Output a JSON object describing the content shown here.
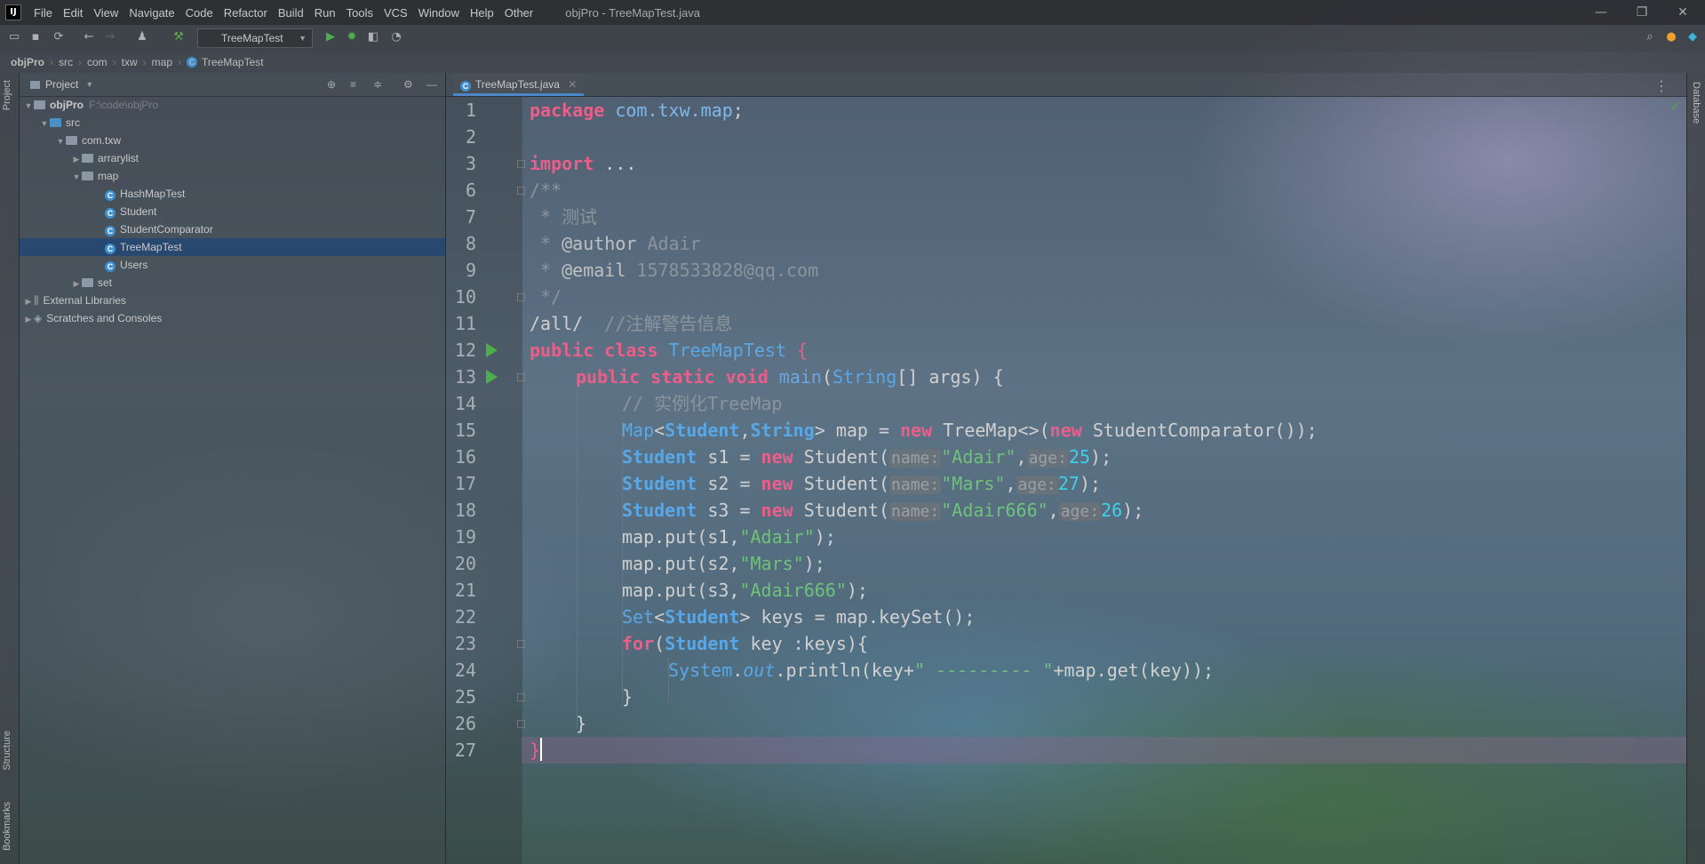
{
  "titlebar": {
    "logo": "IJ",
    "menu": [
      "File",
      "Edit",
      "View",
      "Navigate",
      "Code",
      "Refactor",
      "Build",
      "Run",
      "Tools",
      "VCS",
      "Window",
      "Help",
      "Other"
    ],
    "title": "objPro - TreeMapTest.java",
    "minimize": "—",
    "restore": "❐",
    "close": "✕"
  },
  "toolbar": {
    "run_config": "TreeMapTest"
  },
  "breadcrumb": [
    "objPro",
    "src",
    "com",
    "txw",
    "map",
    "TreeMapTest"
  ],
  "left_strip": {
    "project_tab": "Project",
    "structure_tab": "Structure",
    "bookmarks_tab": "Bookmarks"
  },
  "right_strip": {
    "database_tab": "Database"
  },
  "project_panel": {
    "title": "Project",
    "tree": [
      {
        "label": "objPro",
        "hint": "F:\\code\\objPro"
      },
      {
        "label": "src"
      },
      {
        "label": "com.txw"
      },
      {
        "label": "arrarylist"
      },
      {
        "label": "map"
      },
      {
        "label": "HashMapTest"
      },
      {
        "label": "Student"
      },
      {
        "label": "StudentComparator"
      },
      {
        "label": "TreeMapTest"
      },
      {
        "label": "Users"
      },
      {
        "label": "set"
      },
      {
        "label": "External Libraries"
      },
      {
        "label": "Scratches and Consoles"
      }
    ]
  },
  "editor": {
    "tab_label": "TreeMapTest.java",
    "line_numbers": [
      "1",
      "2",
      "3",
      "6",
      "7",
      "8",
      "9",
      "10",
      "11",
      "12",
      "13",
      "14",
      "15",
      "16",
      "17",
      "18",
      "19",
      "20",
      "21",
      "22",
      "23",
      "24",
      "25",
      "26",
      "27"
    ],
    "code": {
      "l1_kw": "package",
      "l1_pkg": "com.txw.map",
      "l1_end": ";",
      "l3_kw": "import",
      "l3_rest": " ...",
      "l6": "/**",
      "l7": " * 测试",
      "l8_a": " * ",
      "l8_tag": "@author",
      "l8_b": " Adair",
      "l9_a": " * ",
      "l9_tag": "@email",
      "l9_b": " 1578533828@qq.com",
      "l10": " */",
      "l11_a": "/all/  ",
      "l11_cmt": "//注解警告信息",
      "l12_kw": "public class",
      "l12_name": "TreeMapTest",
      "l12_brace": "{",
      "l13_kw": "public static void",
      "l13_fn": "main",
      "l13_type": "String",
      "l13_rest": "[] args) {",
      "l14": "// 实例化TreeMap",
      "l15_map": "Map",
      "l15_lt": "<",
      "l15_t1": "Student",
      "l15_c": ",",
      "l15_t2": "String",
      "l15_rest1": "> map = ",
      "l15_new1": "new",
      "l15_rest2": " TreeMap<>(",
      "l15_new2": "new",
      "l15_rest3": " StudentComparator());",
      "s_type": "Student",
      "new": "new",
      "name_hint": "name:",
      "age_hint": "age:",
      "l16_a": " s1 = ",
      "l16_ctor": " Student(",
      "l16_str": "\"Adair\"",
      "l16_num": "25",
      "l17_a": " s2 = ",
      "l17_str": "\"Mars\"",
      "l17_num": "27",
      "l18_a": " s3 = ",
      "l18_str": "\"Adair666\"",
      "l18_num": "26",
      "comma": ",",
      "close": ");",
      "l19_a": "map.put(s1,",
      "l19_str": "\"Adair\"",
      "l20_a": "map.put(s2,",
      "l20_str": "\"Mars\"",
      "l21_a": "map.put(s3,",
      "l21_str": "\"Adair666\"",
      "l22_set": "Set",
      "l22_rest": " keys = map.keySet();",
      "l23_kw": "for",
      "l23_rest": " key :keys){",
      "l24_sys": "System",
      "l24_dot": ".",
      "l24_out": "out",
      "l24_a": ".println(key+",
      "l24_str": "\" --------- \"",
      "l24_b": "+map.get(key));",
      "l25": "}",
      "l26": "}",
      "l27": "}"
    }
  }
}
